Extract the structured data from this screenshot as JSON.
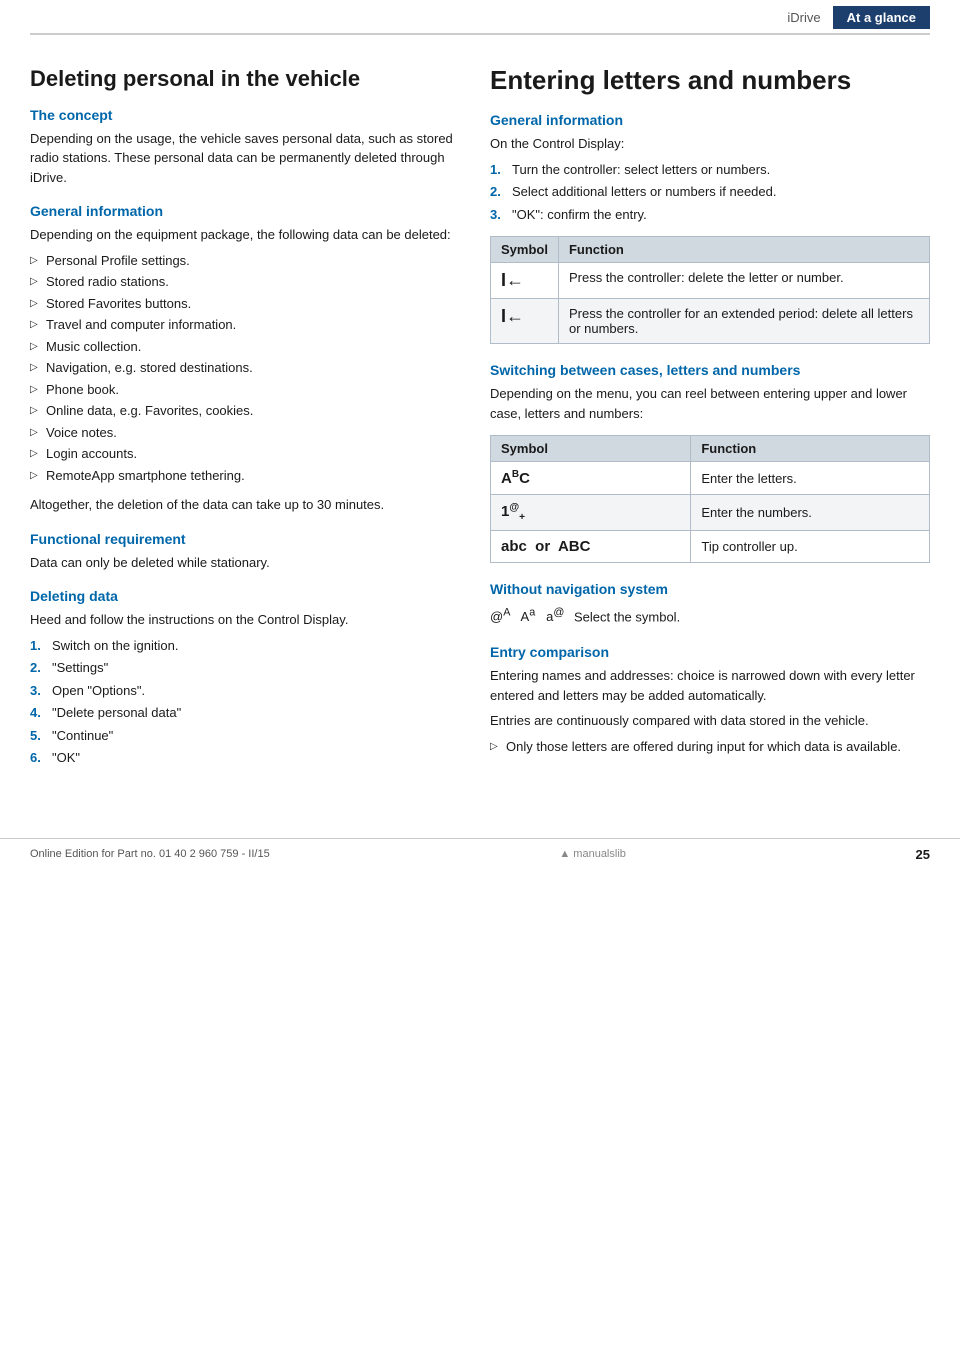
{
  "header": {
    "idrive_label": "iDrive",
    "at_a_glance_label": "At a glance"
  },
  "left": {
    "main_title": "Deleting personal in the vehicle",
    "concept_heading": "The concept",
    "concept_text": "Depending on the usage, the vehicle saves personal data, such as stored radio stations. These personal data can be permanently deleted through iDrive.",
    "general_info_heading": "General information",
    "general_info_text": "Depending on the equipment package, the following data can be deleted:",
    "bullet_items": [
      "Personal Profile settings.",
      "Stored radio stations.",
      "Stored Favorites buttons.",
      "Travel and computer information.",
      "Music collection.",
      "Navigation, e.g. stored destinations.",
      "Phone book.",
      "Online data, e.g. Favorites, cookies.",
      "Voice notes.",
      "Login accounts.",
      "RemoteApp smartphone tethering."
    ],
    "general_info_footer": "Altogether, the deletion of the data can take up to 30 minutes.",
    "functional_req_heading": "Functional requirement",
    "functional_req_text": "Data can only be deleted while stationary.",
    "deleting_data_heading": "Deleting data",
    "deleting_data_text": "Heed and follow the instructions on the Control Display.",
    "steps": [
      {
        "num": "1.",
        "text": "Switch on the ignition."
      },
      {
        "num": "2.",
        "text": "\"Settings\""
      },
      {
        "num": "3.",
        "text": "Open \"Options\"."
      },
      {
        "num": "4.",
        "text": "\"Delete personal data\""
      },
      {
        "num": "5.",
        "text": "\"Continue\""
      },
      {
        "num": "6.",
        "text": "\"OK\""
      }
    ]
  },
  "right": {
    "main_title": "Entering letters and numbers",
    "general_info_heading": "General information",
    "general_info_intro": "On the Control Display:",
    "steps": [
      {
        "num": "1.",
        "text": "Turn the controller: select letters or numbers."
      },
      {
        "num": "2.",
        "text": "Select additional letters or numbers if needed."
      },
      {
        "num": "3.",
        "text": "\"OK\": confirm the entry."
      }
    ],
    "symbol_table": {
      "col1": "Symbol",
      "col2": "Function",
      "rows": [
        {
          "symbol": "I←",
          "function": "Press the controller: delete the letter or number."
        },
        {
          "symbol": "I←",
          "function": "Press the controller for an extended period: delete all letters or numbers."
        }
      ]
    },
    "switching_heading": "Switching between cases, letters and numbers",
    "switching_text": "Depending on the menu, you can reel between entering upper and lower case, letters and numbers:",
    "switch_table": {
      "col1": "Symbol",
      "col2": "Function",
      "rows": [
        {
          "symbol": "AᴬC",
          "function": "Enter the letters."
        },
        {
          "symbol": "1®₊",
          "function": "Enter the numbers."
        },
        {
          "symbol": "abc  or  ABC",
          "function": "Tip controller up."
        }
      ]
    },
    "without_nav_heading": "Without navigation system",
    "without_nav_text": "Select the symbol.",
    "without_nav_symbols": "@ᴬ  Aᵃ  aᶦ",
    "entry_comparison_heading": "Entry comparison",
    "entry_comparison_text1": "Entering names and addresses: choice is narrowed down with every letter entered and letters may be added automatically.",
    "entry_comparison_text2": "Entries are continuously compared with data stored in the vehicle.",
    "entry_bullet": "Only those letters are offered during input for which data is available."
  },
  "footer": {
    "text": "Online Edition for Part no. 01 40 2 960 759 - II/15",
    "page": "25",
    "logo": "manualslib"
  }
}
